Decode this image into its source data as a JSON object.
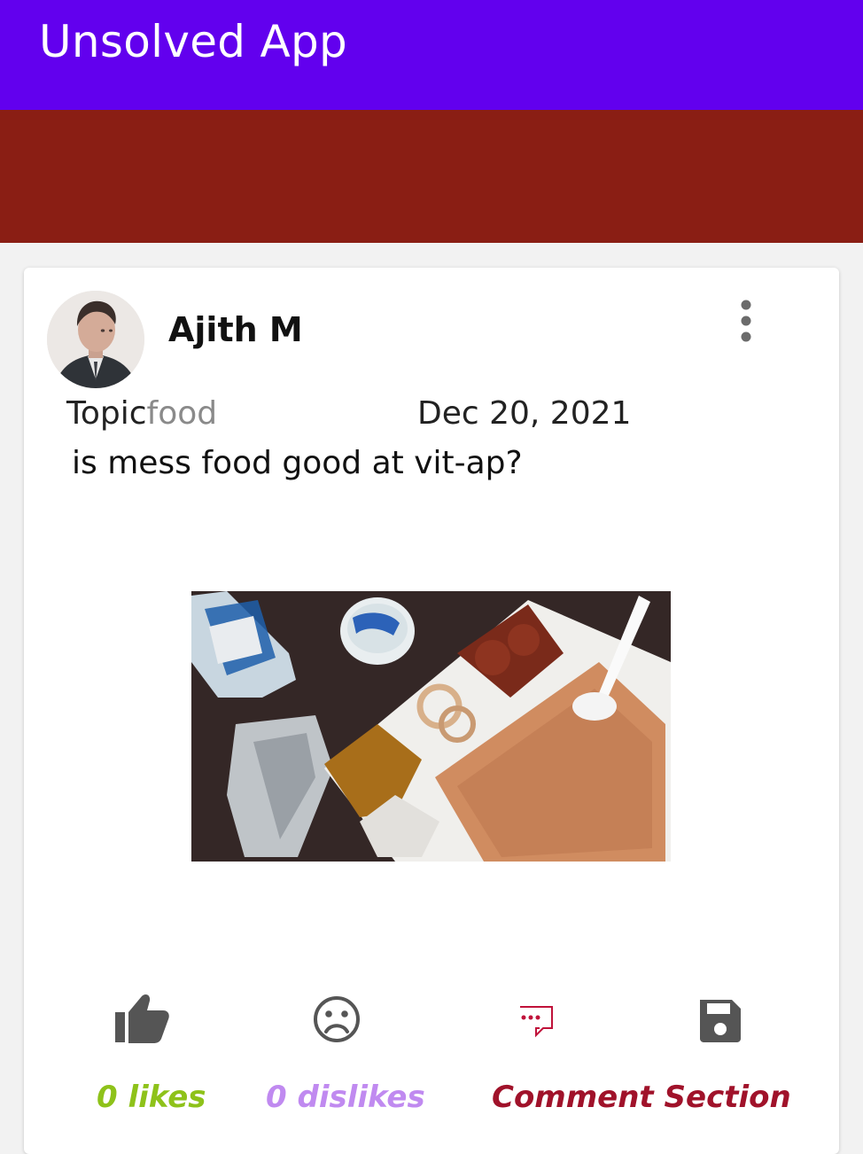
{
  "appbar": {
    "title": "Unsolved App"
  },
  "post": {
    "author": "Ajith M",
    "topic_label": "Topic",
    "topic_value": "food",
    "date": "Dec 20, 2021",
    "question": "is mess food good at vit-ap?",
    "image_subject": "mess food tray with fried rice, curry, onion rings and gravy"
  },
  "actions": {
    "likes_label": "0 likes",
    "dislikes_label": "0 dislikes",
    "comment_label": "Comment Section",
    "icons": [
      "thumbs-up-icon",
      "sad-face-icon",
      "comment-icon",
      "save-icon"
    ]
  },
  "colors": {
    "appbar": "#6200ee",
    "banner": "#8a1e14",
    "likes": "#8ec21a",
    "dislikes": "#c08af0",
    "comment": "#a0122a"
  }
}
